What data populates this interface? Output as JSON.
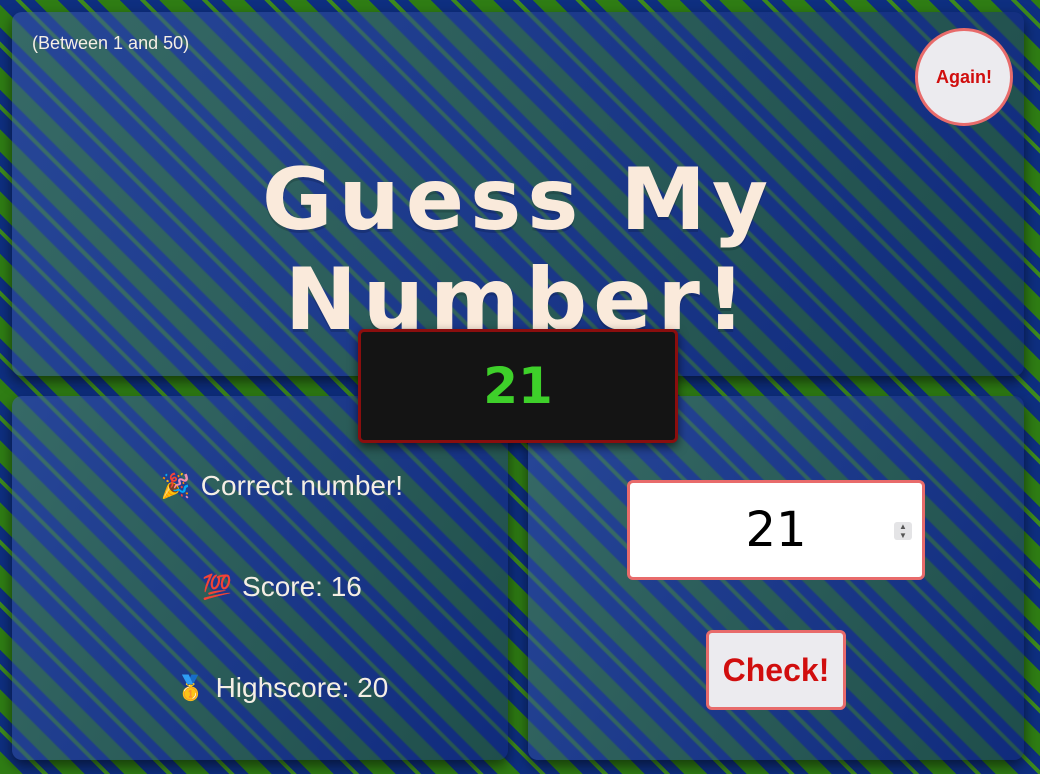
{
  "header": {
    "range_hint": "(Between 1 and 50)",
    "again_label": "Again!",
    "title": "Guess My Number!"
  },
  "secret_number": "21",
  "stats": {
    "message_icon": "🎉",
    "message": "Correct number!",
    "score_icon": "💯",
    "score_label": "Score: 16",
    "highscore_icon": "🥇",
    "highscore_label": "Highscore: 20"
  },
  "guess": {
    "value": "21",
    "check_label": "Check!"
  },
  "colors": {
    "accent_red": "#d10e0e",
    "border_pink": "#e86b6b",
    "number_green": "#3ed02a",
    "title_cream": "#faeadb",
    "bg_green": "#2f7d14",
    "bg_blue": "#0e2f80"
  }
}
